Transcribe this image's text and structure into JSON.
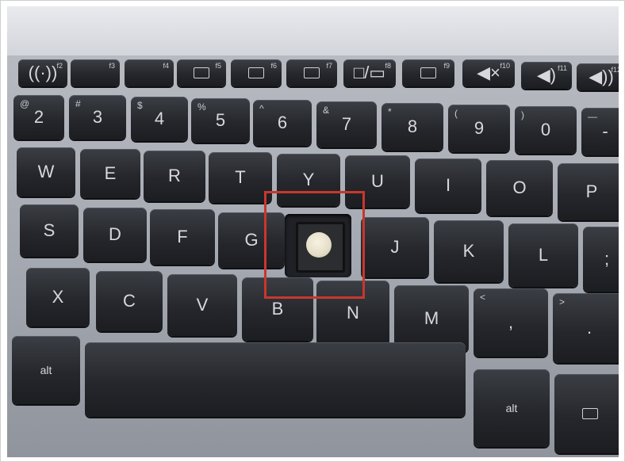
{
  "image": {
    "subject": "laptop keyboard with one key cap removed",
    "highlight_color": "#c8372d"
  },
  "function_row": [
    {
      "label": "f2"
    },
    {
      "label": "f3"
    },
    {
      "label": "f4"
    },
    {
      "label": "f5"
    },
    {
      "label": "f6"
    },
    {
      "label": "f7"
    },
    {
      "label": "f8"
    },
    {
      "label": "f9"
    },
    {
      "label": "f10"
    },
    {
      "label": "f11"
    },
    {
      "label": "f12"
    }
  ],
  "number_row": [
    {
      "cap": "2",
      "sym": "@"
    },
    {
      "cap": "3",
      "sym": "#"
    },
    {
      "cap": "4",
      "sym": "$"
    },
    {
      "cap": "5",
      "sym": "%"
    },
    {
      "cap": "6",
      "sym": "^"
    },
    {
      "cap": "7",
      "sym": "&"
    },
    {
      "cap": "8",
      "sym": "*"
    },
    {
      "cap": "9",
      "sym": "("
    },
    {
      "cap": "0",
      "sym": ")"
    },
    {
      "cap": "-",
      "sym": "—"
    }
  ],
  "top_row": [
    "W",
    "E",
    "R",
    "T",
    "Y",
    "U",
    "I",
    "O",
    "P"
  ],
  "home_row": [
    "S",
    "D",
    "F",
    "G",
    "J",
    "K",
    "L",
    ";"
  ],
  "bottom_row": [
    "X",
    "C",
    "V",
    "B",
    "N",
    "M",
    "<",
    ">"
  ],
  "bottom_row_syms": [
    ",",
    "."
  ],
  "modifiers": {
    "left_alt": "alt",
    "right_alt": "alt"
  }
}
